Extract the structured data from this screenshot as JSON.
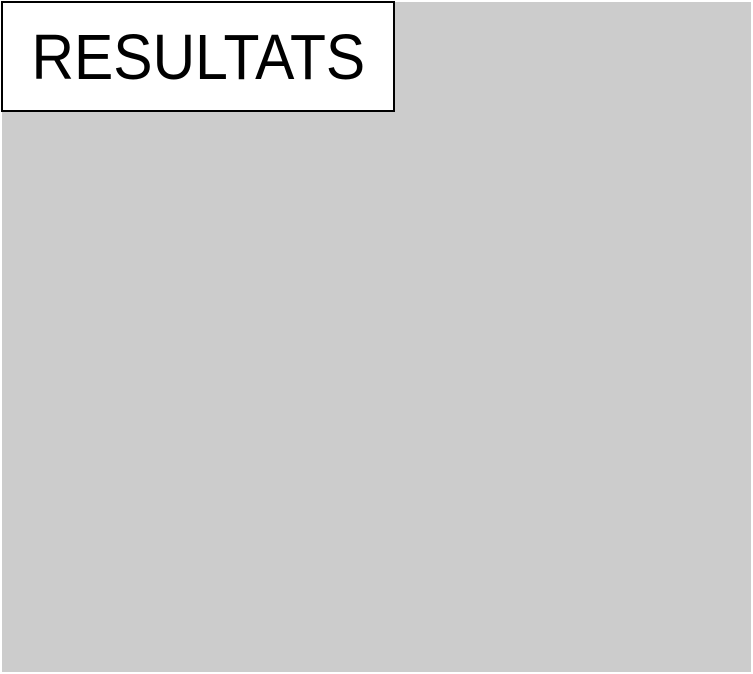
{
  "title": "RESULTATS",
  "colors": {
    "panel_background": "#cccccc",
    "title_background": "#ffffff",
    "title_border": "#000000",
    "title_text": "#000000"
  }
}
